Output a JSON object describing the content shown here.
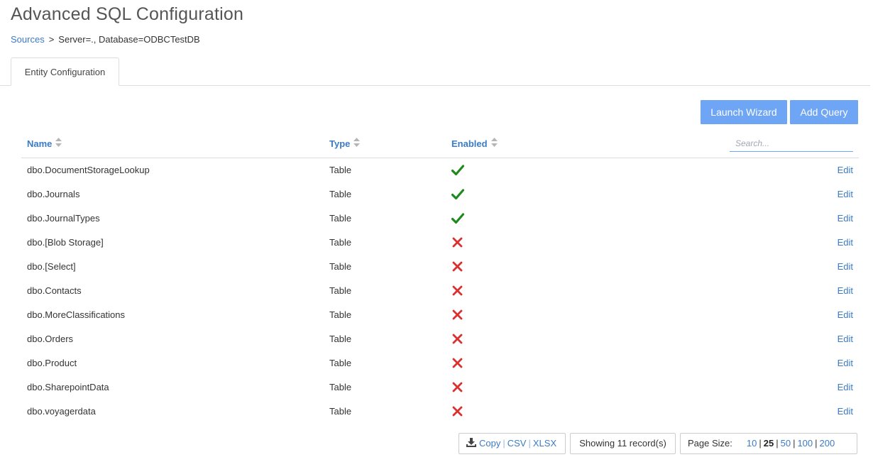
{
  "page": {
    "title": "Advanced SQL Configuration"
  },
  "breadcrumb": {
    "root": "Sources",
    "separator": ">",
    "current": "Server=., Database=ODBCTestDB"
  },
  "tabs": [
    {
      "label": "Entity Configuration",
      "active": true
    }
  ],
  "toolbar": {
    "launch_wizard": "Launch Wizard",
    "add_query": "Add Query"
  },
  "table": {
    "columns": {
      "name": "Name",
      "type": "Type",
      "enabled": "Enabled"
    },
    "search_placeholder": "Search...",
    "edit_label": "Edit",
    "rows": [
      {
        "name": "dbo.DocumentStorageLookup",
        "type": "Table",
        "enabled": true
      },
      {
        "name": "dbo.Journals",
        "type": "Table",
        "enabled": true
      },
      {
        "name": "dbo.JournalTypes",
        "type": "Table",
        "enabled": true
      },
      {
        "name": "dbo.[Blob Storage]",
        "type": "Table",
        "enabled": false
      },
      {
        "name": "dbo.[Select]",
        "type": "Table",
        "enabled": false
      },
      {
        "name": "dbo.Contacts",
        "type": "Table",
        "enabled": false
      },
      {
        "name": "dbo.MoreClassifications",
        "type": "Table",
        "enabled": false
      },
      {
        "name": "dbo.Orders",
        "type": "Table",
        "enabled": false
      },
      {
        "name": "dbo.Product",
        "type": "Table",
        "enabled": false
      },
      {
        "name": "dbo.SharepointData",
        "type": "Table",
        "enabled": false
      },
      {
        "name": "dbo.voyagerdata",
        "type": "Table",
        "enabled": false
      }
    ]
  },
  "footer": {
    "export": {
      "copy": "Copy",
      "csv": "CSV",
      "xlsx": "XLSX",
      "icon": "download-icon"
    },
    "record_count": "Showing 11 record(s)",
    "page_size_label": "Page Size:",
    "page_sizes": [
      "10",
      "25",
      "50",
      "100",
      "200"
    ],
    "current_page_size": "25"
  },
  "colors": {
    "accent": "#3a7bc8",
    "button": "#6ea5f5",
    "check": "#1e8a1e",
    "cross": "#d93030"
  }
}
